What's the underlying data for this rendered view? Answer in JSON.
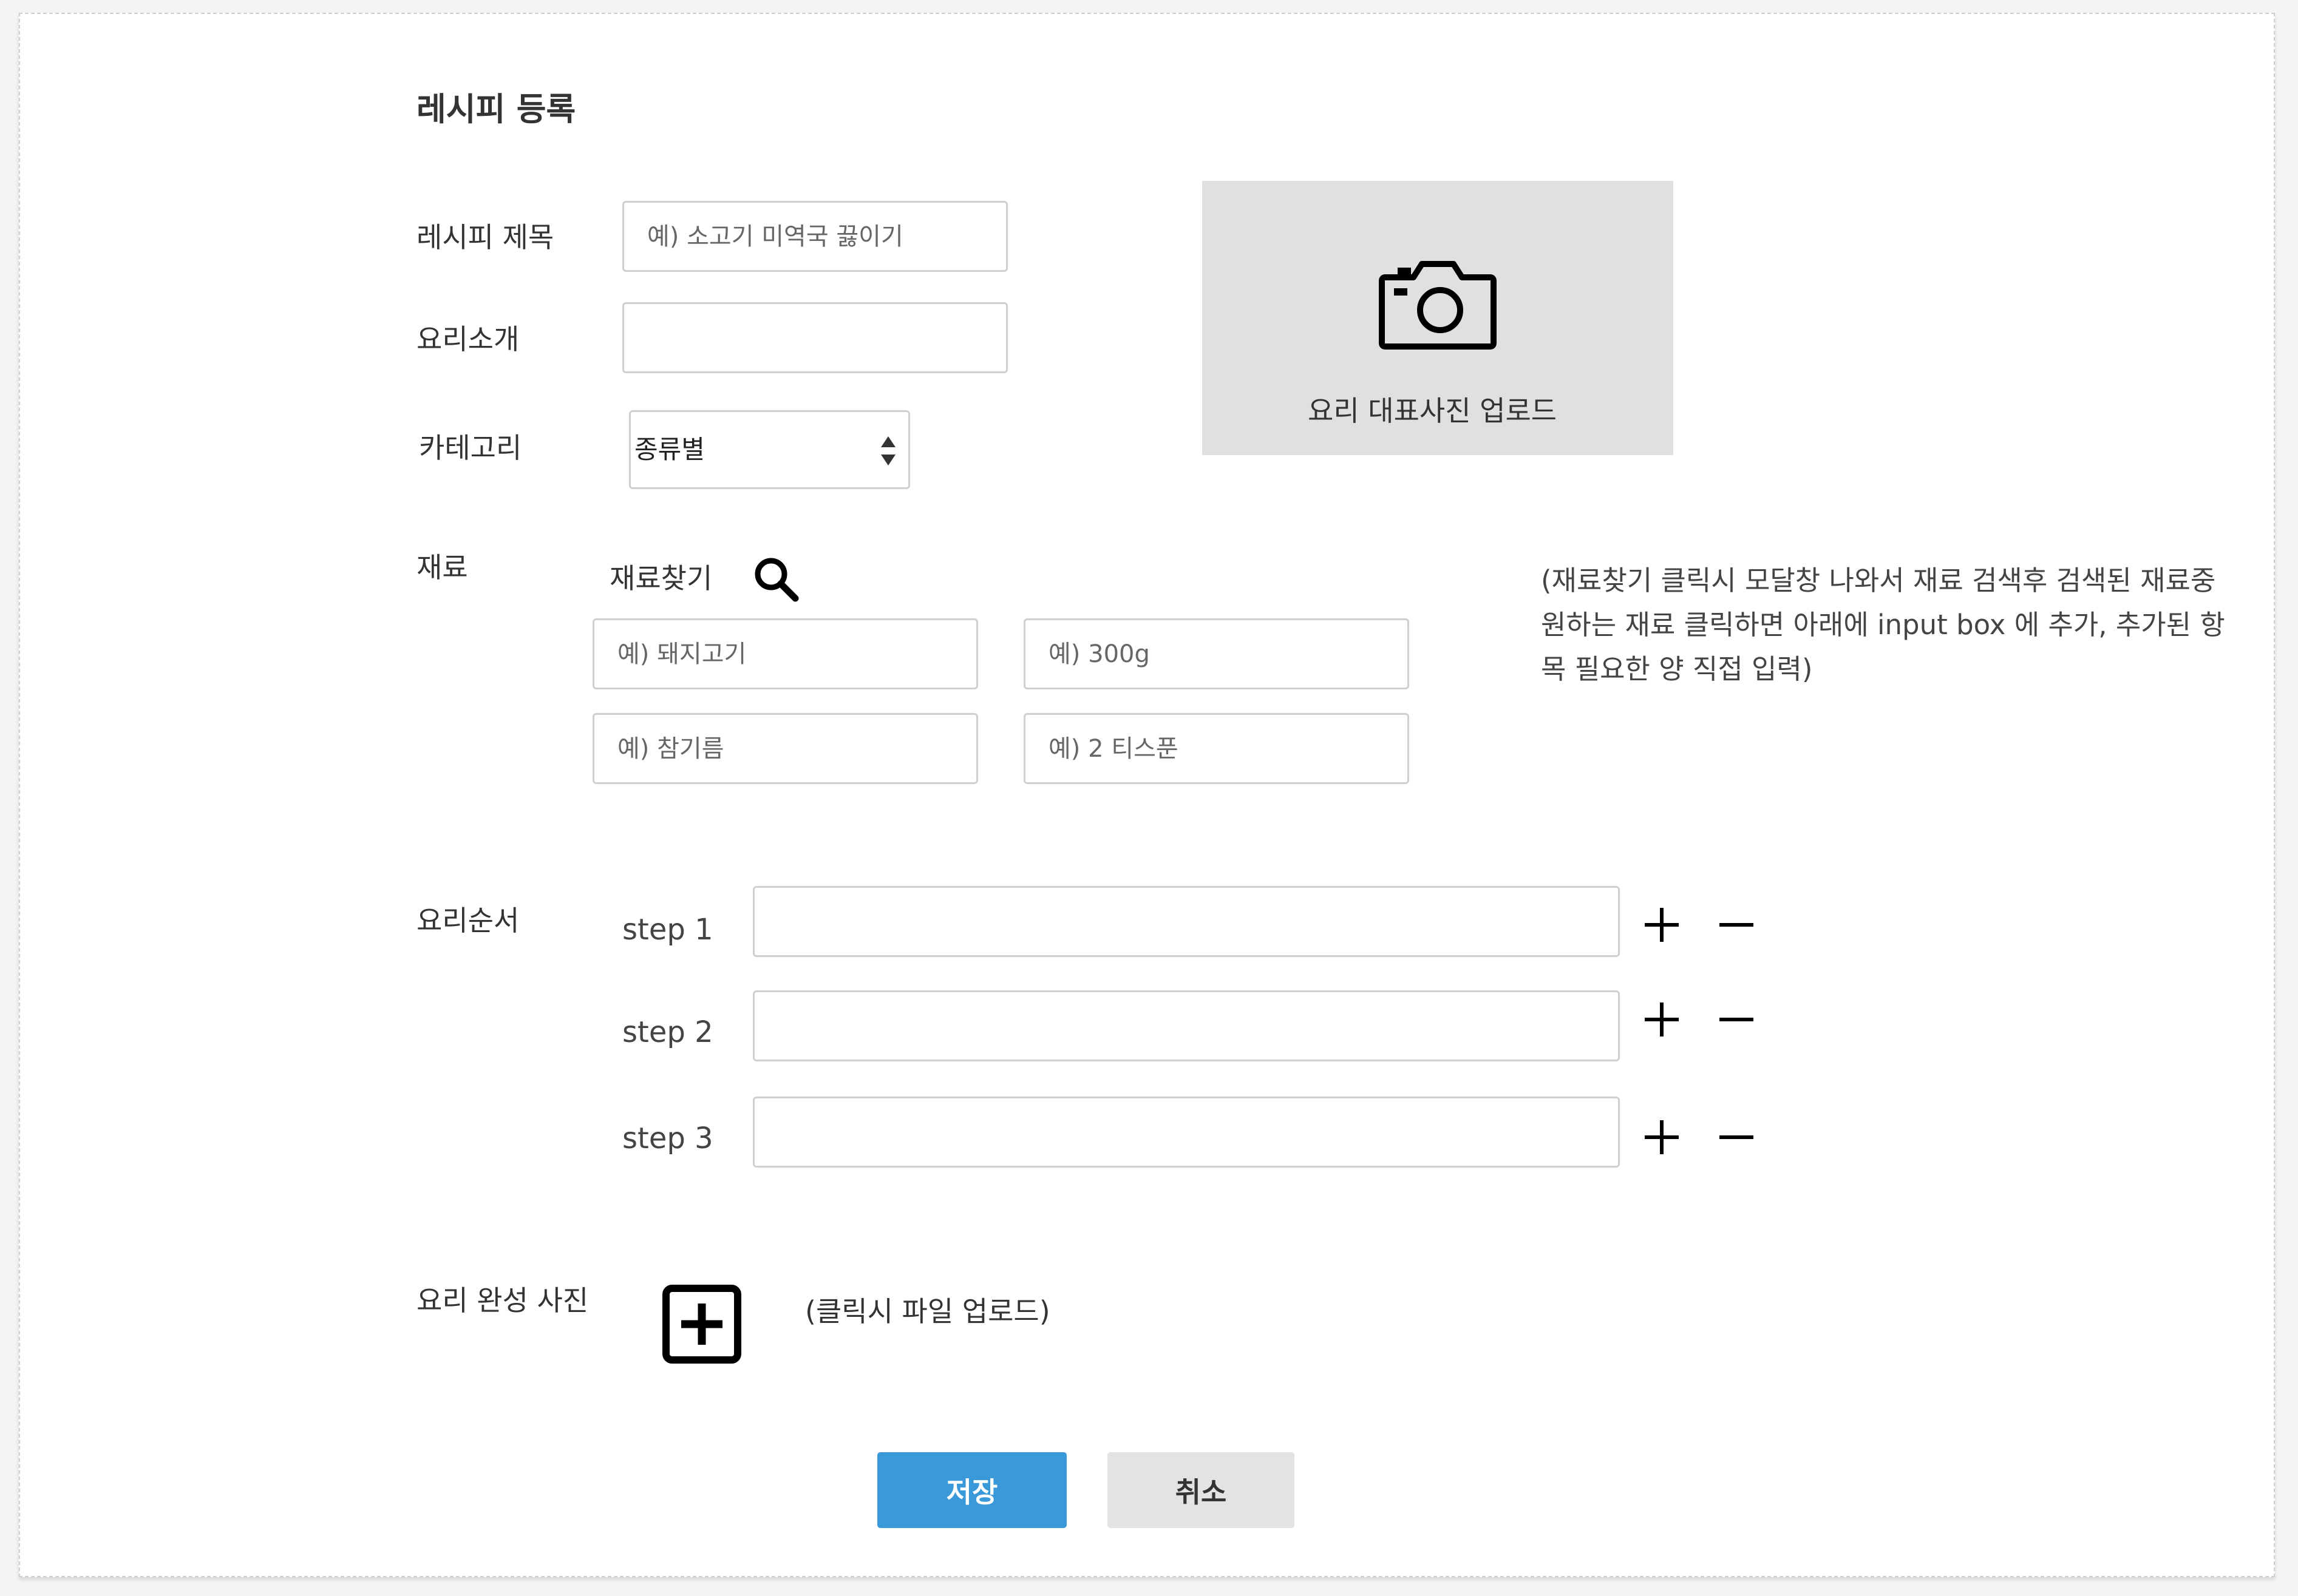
{
  "page": {
    "title": "레시피 등록"
  },
  "form": {
    "recipe_title": {
      "label": "레시피 제목",
      "placeholder": "예) 소고기 미역국 끓이기",
      "value": ""
    },
    "intro": {
      "label": "요리소개",
      "placeholder": "",
      "value": ""
    },
    "category": {
      "label": "카테고리",
      "selected": "종류별"
    }
  },
  "photo_upload": {
    "label": "요리 대표사진 업로드",
    "icon": "camera-icon"
  },
  "ingredients": {
    "label": "재료",
    "search_label": "재료찾기",
    "search_icon": "search-icon",
    "note": "(재료찾기 클릭시 모달창 나와서 재료 검색후 검색된 재료중 원하는 재료 클릭하면 아래에 input box 에 추가, 추가된 항목 필요한 양 직접 입력)",
    "rows": [
      {
        "name_placeholder": "예) 돼지고기",
        "amount_placeholder": "예) 300g"
      },
      {
        "name_placeholder": "예) 참기름",
        "amount_placeholder": "예) 2 티스푼"
      }
    ]
  },
  "steps": {
    "label": "요리순서",
    "items": [
      {
        "label": "step 1",
        "value": ""
      },
      {
        "label": "step 2",
        "value": ""
      },
      {
        "label": "step 3",
        "value": ""
      }
    ]
  },
  "completion_photo": {
    "label": "요리 완성 사진",
    "hint": "(클릭시 파일 업로드)"
  },
  "actions": {
    "save": "저장",
    "cancel": "취소"
  },
  "colors": {
    "accent": "#3a9ad9",
    "upload_bg": "#e0e0e0",
    "cancel_bg": "#e3e3e3",
    "border": "#cfcfcf"
  }
}
